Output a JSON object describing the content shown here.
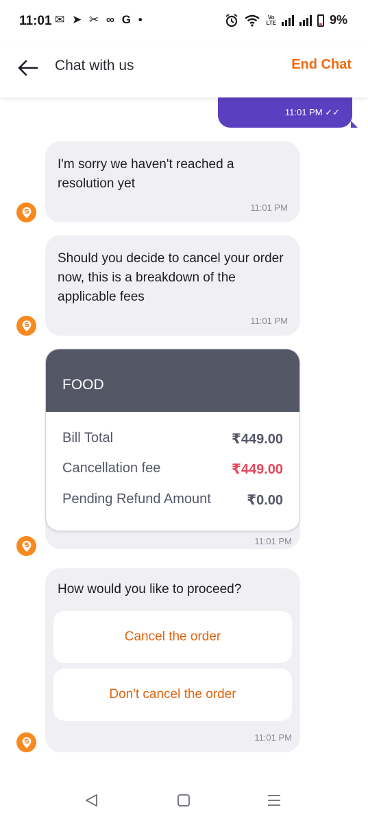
{
  "status_bar": {
    "time": "11:01",
    "notification_icons": "✉ ➤ ✂ ∞ G •",
    "network_label_top": "Vo",
    "network_label_bottom": "LTE",
    "battery": "9%"
  },
  "header": {
    "title": "Chat with us",
    "end_chat_label": "End Chat"
  },
  "messages": {
    "user_time": "11:01 PM ✓✓",
    "agent_1_text": "I'm sorry we haven't reached a resolution yet",
    "agent_1_time": "11:01 PM",
    "agent_2_text": "Should you decide to cancel your order now, this is a breakdown of the applicable fees",
    "agent_2_time": "11:01 PM"
  },
  "fee_card": {
    "title": "FOOD",
    "rows": [
      {
        "label": "Bill Total",
        "value": "₹449.00"
      },
      {
        "label": "Cancellation fee",
        "value": "₹449.00"
      },
      {
        "label": "Pending Refund Amount",
        "value": "₹0.00"
      }
    ],
    "time": "11:01 PM"
  },
  "options": {
    "question": "How would you like to proceed?",
    "buttons": [
      "Cancel the order",
      "Don't cancel the order"
    ],
    "time": "11:01 PM"
  },
  "colors": {
    "accent": "#f06a0f",
    "user_bubble": "#5a3fc0",
    "agent_bubble": "#f0f0f4",
    "fee_header": "#545866",
    "fee_red": "#e8475c",
    "avatar": "#f7891f"
  },
  "icons": [
    "back-arrow-icon",
    "swiggy-logo-icon",
    "double-check-icon",
    "nav-back-icon",
    "nav-home-icon",
    "nav-menu-icon"
  ]
}
